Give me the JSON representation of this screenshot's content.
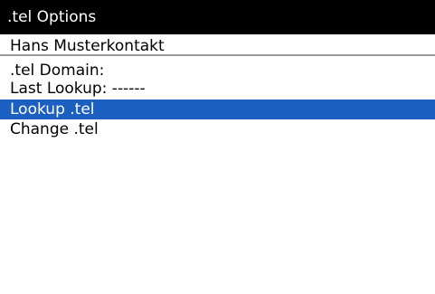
{
  "screen": {
    "title": ".tel Options"
  },
  "contact": {
    "name": "Hans Musterkontakt"
  },
  "info": {
    "domain_label": ".tel Domain:",
    "last_lookup": "Last Lookup: ------"
  },
  "menu": {
    "items": [
      {
        "label": "Lookup .tel",
        "selected": true
      },
      {
        "label": "Change .tel",
        "selected": false
      }
    ]
  },
  "colors": {
    "title_bar_bg": "#000000",
    "selection_bg": "#1b5fc0",
    "divider": "#9a9a9a"
  }
}
